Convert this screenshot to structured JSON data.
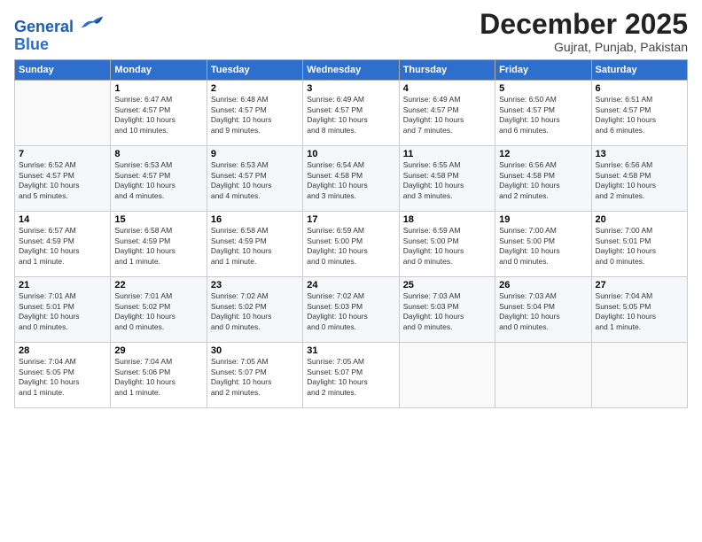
{
  "logo": {
    "line1": "General",
    "line2": "Blue"
  },
  "title": "December 2025",
  "location": "Gujrat, Punjab, Pakistan",
  "days_header": [
    "Sunday",
    "Monday",
    "Tuesday",
    "Wednesday",
    "Thursday",
    "Friday",
    "Saturday"
  ],
  "weeks": [
    [
      {
        "num": "",
        "info": ""
      },
      {
        "num": "1",
        "info": "Sunrise: 6:47 AM\nSunset: 4:57 PM\nDaylight: 10 hours\nand 10 minutes."
      },
      {
        "num": "2",
        "info": "Sunrise: 6:48 AM\nSunset: 4:57 PM\nDaylight: 10 hours\nand 9 minutes."
      },
      {
        "num": "3",
        "info": "Sunrise: 6:49 AM\nSunset: 4:57 PM\nDaylight: 10 hours\nand 8 minutes."
      },
      {
        "num": "4",
        "info": "Sunrise: 6:49 AM\nSunset: 4:57 PM\nDaylight: 10 hours\nand 7 minutes."
      },
      {
        "num": "5",
        "info": "Sunrise: 6:50 AM\nSunset: 4:57 PM\nDaylight: 10 hours\nand 6 minutes."
      },
      {
        "num": "6",
        "info": "Sunrise: 6:51 AM\nSunset: 4:57 PM\nDaylight: 10 hours\nand 6 minutes."
      }
    ],
    [
      {
        "num": "7",
        "info": "Sunrise: 6:52 AM\nSunset: 4:57 PM\nDaylight: 10 hours\nand 5 minutes."
      },
      {
        "num": "8",
        "info": "Sunrise: 6:53 AM\nSunset: 4:57 PM\nDaylight: 10 hours\nand 4 minutes."
      },
      {
        "num": "9",
        "info": "Sunrise: 6:53 AM\nSunset: 4:57 PM\nDaylight: 10 hours\nand 4 minutes."
      },
      {
        "num": "10",
        "info": "Sunrise: 6:54 AM\nSunset: 4:58 PM\nDaylight: 10 hours\nand 3 minutes."
      },
      {
        "num": "11",
        "info": "Sunrise: 6:55 AM\nSunset: 4:58 PM\nDaylight: 10 hours\nand 3 minutes."
      },
      {
        "num": "12",
        "info": "Sunrise: 6:56 AM\nSunset: 4:58 PM\nDaylight: 10 hours\nand 2 minutes."
      },
      {
        "num": "13",
        "info": "Sunrise: 6:56 AM\nSunset: 4:58 PM\nDaylight: 10 hours\nand 2 minutes."
      }
    ],
    [
      {
        "num": "14",
        "info": "Sunrise: 6:57 AM\nSunset: 4:59 PM\nDaylight: 10 hours\nand 1 minute."
      },
      {
        "num": "15",
        "info": "Sunrise: 6:58 AM\nSunset: 4:59 PM\nDaylight: 10 hours\nand 1 minute."
      },
      {
        "num": "16",
        "info": "Sunrise: 6:58 AM\nSunset: 4:59 PM\nDaylight: 10 hours\nand 1 minute."
      },
      {
        "num": "17",
        "info": "Sunrise: 6:59 AM\nSunset: 5:00 PM\nDaylight: 10 hours\nand 0 minutes."
      },
      {
        "num": "18",
        "info": "Sunrise: 6:59 AM\nSunset: 5:00 PM\nDaylight: 10 hours\nand 0 minutes."
      },
      {
        "num": "19",
        "info": "Sunrise: 7:00 AM\nSunset: 5:00 PM\nDaylight: 10 hours\nand 0 minutes."
      },
      {
        "num": "20",
        "info": "Sunrise: 7:00 AM\nSunset: 5:01 PM\nDaylight: 10 hours\nand 0 minutes."
      }
    ],
    [
      {
        "num": "21",
        "info": "Sunrise: 7:01 AM\nSunset: 5:01 PM\nDaylight: 10 hours\nand 0 minutes."
      },
      {
        "num": "22",
        "info": "Sunrise: 7:01 AM\nSunset: 5:02 PM\nDaylight: 10 hours\nand 0 minutes."
      },
      {
        "num": "23",
        "info": "Sunrise: 7:02 AM\nSunset: 5:02 PM\nDaylight: 10 hours\nand 0 minutes."
      },
      {
        "num": "24",
        "info": "Sunrise: 7:02 AM\nSunset: 5:03 PM\nDaylight: 10 hours\nand 0 minutes."
      },
      {
        "num": "25",
        "info": "Sunrise: 7:03 AM\nSunset: 5:03 PM\nDaylight: 10 hours\nand 0 minutes."
      },
      {
        "num": "26",
        "info": "Sunrise: 7:03 AM\nSunset: 5:04 PM\nDaylight: 10 hours\nand 0 minutes."
      },
      {
        "num": "27",
        "info": "Sunrise: 7:04 AM\nSunset: 5:05 PM\nDaylight: 10 hours\nand 1 minute."
      }
    ],
    [
      {
        "num": "28",
        "info": "Sunrise: 7:04 AM\nSunset: 5:05 PM\nDaylight: 10 hours\nand 1 minute."
      },
      {
        "num": "29",
        "info": "Sunrise: 7:04 AM\nSunset: 5:06 PM\nDaylight: 10 hours\nand 1 minute."
      },
      {
        "num": "30",
        "info": "Sunrise: 7:05 AM\nSunset: 5:07 PM\nDaylight: 10 hours\nand 2 minutes."
      },
      {
        "num": "31",
        "info": "Sunrise: 7:05 AM\nSunset: 5:07 PM\nDaylight: 10 hours\nand 2 minutes."
      },
      {
        "num": "",
        "info": ""
      },
      {
        "num": "",
        "info": ""
      },
      {
        "num": "",
        "info": ""
      }
    ]
  ]
}
